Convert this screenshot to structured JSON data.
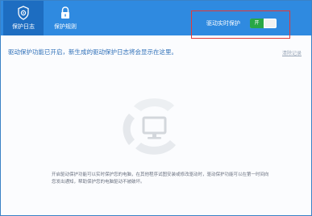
{
  "tabs": {
    "log": "保护日志",
    "rules": "保护规则"
  },
  "driver_protection": {
    "label": "驱动实时保护",
    "state": "开"
  },
  "main": {
    "notice": "驱动保护功能已开启，新生成的驱动保护日志将会显示在这里。",
    "clear_link": "清除记录",
    "description_line1": "开启驱动保护功能可以实时保护您的电脑，在其他程序试图安装或修改驱动时，驱动保护功能可以在第一时间向",
    "description_line2": "您发出通知，帮助保护您的电脑驱动不被破坏。"
  },
  "colors": {
    "topbar": "#2f8ae0",
    "active_tab": "#1d6dc1",
    "switch_on": "#28a745",
    "highlight_box": "#e53935"
  }
}
